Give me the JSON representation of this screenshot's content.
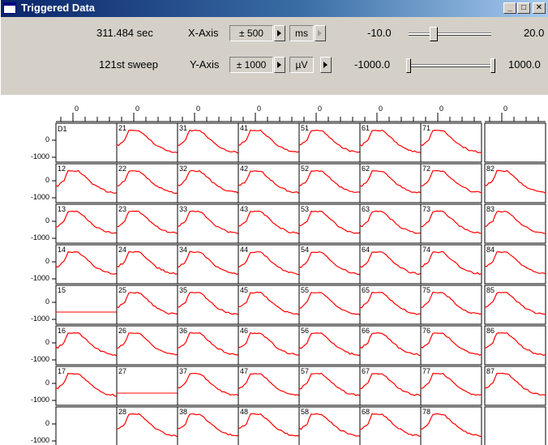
{
  "window": {
    "title": "Triggered Data",
    "minimize_glyph": "_",
    "maximize_glyph": "□",
    "close_glyph": "✕"
  },
  "toolbar": {
    "time_readout": "311.484 sec",
    "sweep_readout": "121st sweep",
    "x_axis": {
      "label": "X-Axis",
      "range": "± 500",
      "unit": "ms",
      "min": "-10.0",
      "max": "20.0",
      "slider_position": 0.28
    },
    "y_axis": {
      "label": "Y-Axis",
      "range": "± 1000",
      "unit": "µV",
      "min": "-1000.0",
      "max": "1000.0",
      "slider_position_low": 0.0,
      "slider_position_high": 1.0
    }
  },
  "plot": {
    "trace_color": "#ff0000",
    "marker_color": "#0000ff",
    "x_tick_label": "0",
    "y_label_zero": "0",
    "y_label_min": "-1000",
    "first_channel_label": "D1",
    "grid": [
      [
        null,
        "21",
        "31",
        "41",
        "51",
        "61",
        "71",
        null
      ],
      [
        "12",
        "22",
        "32",
        "42",
        "52",
        "62",
        "72",
        "82"
      ],
      [
        "13",
        "23",
        "33",
        "43",
        "53",
        "63",
        "73",
        "83"
      ],
      [
        "14",
        "24",
        "34",
        "44",
        "54",
        "64",
        "74",
        "84"
      ],
      [
        "15",
        "25",
        "35",
        "45",
        "55",
        "65",
        "75",
        "85"
      ],
      [
        "16",
        "26",
        "36",
        "46",
        "56",
        "66",
        "76",
        "86"
      ],
      [
        "17",
        "27",
        "37",
        "47",
        "57",
        "67",
        "77",
        "87"
      ],
      [
        null,
        "28",
        "38",
        "48",
        "58",
        "68",
        "78",
        null
      ]
    ],
    "flat_channels": [
      "15",
      "27"
    ]
  }
}
